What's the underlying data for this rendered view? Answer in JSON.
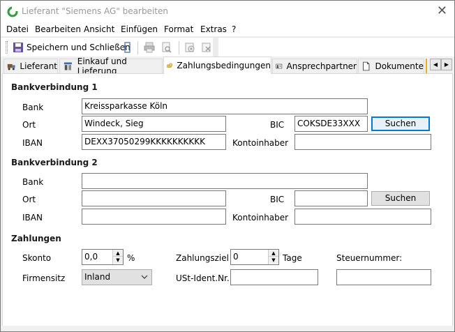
{
  "window": {
    "title": "Lieferant \"Siemens AG\" bearbeiten"
  },
  "menu": {
    "items": [
      {
        "label": "Datei"
      },
      {
        "label": "Bearbeiten"
      },
      {
        "label": "Ansicht"
      },
      {
        "label": "Einfügen"
      },
      {
        "label": "Format"
      },
      {
        "label": "Extras"
      },
      {
        "label": "?"
      }
    ]
  },
  "toolbar": {
    "save_label": "Speichern und Schließen",
    "icons": [
      "save-icon",
      "export-icon",
      "print-icon",
      "print-preview-icon",
      "new-record-icon",
      "delete-record-icon"
    ]
  },
  "tabs": [
    {
      "label": "Lieferant",
      "icon": "truck-icon"
    },
    {
      "label": "Einkauf und Lieferung",
      "icon": "warehouse-icon"
    },
    {
      "label": "Zahlungsbedingungen",
      "icon": "money-icon",
      "active": true
    },
    {
      "label": "Ansprechpartner",
      "icon": "contact-card-icon"
    },
    {
      "label": "Dokumente",
      "icon": "document-icon"
    }
  ],
  "bank1": {
    "section": "Bankverbindung 1",
    "bank_label": "Bank",
    "bank_value": "Kreissparkasse Köln",
    "ort_label": "Ort",
    "ort_value": "Windeck, Sieg",
    "bic_label": "BIC",
    "bic_value": "COKSDE33XXX",
    "search_label": "Suchen",
    "iban_label": "IBAN",
    "iban_value": "DEXX37050299KKKKKKKKKK",
    "holder_label": "Kontoinhaber",
    "holder_value": ""
  },
  "bank2": {
    "section": "Bankverbindung 2",
    "bank_label": "Bank",
    "bank_value": "",
    "ort_label": "Ort",
    "ort_value": "",
    "bic_label": "BIC",
    "bic_value": "",
    "search_label": "Suchen",
    "iban_label": "IBAN",
    "iban_value": "",
    "holder_label": "Kontoinhaber",
    "holder_value": ""
  },
  "payments": {
    "section": "Zahlungen",
    "skonto_label": "Skonto",
    "skonto_value": "0,0",
    "percent": "%",
    "ziel_label": "Zahlungsziel",
    "ziel_value": "0",
    "tage": "Tage",
    "steuer_label": "Steuernummer:",
    "steuer_value": "",
    "firmensitz_label": "Firmensitz",
    "firmensitz_value": "Inland",
    "ust_label": "USt-Ident.Nr.",
    "ust_value": ""
  },
  "colors": {
    "accent": "#0078d7",
    "title_text": "#999999"
  }
}
